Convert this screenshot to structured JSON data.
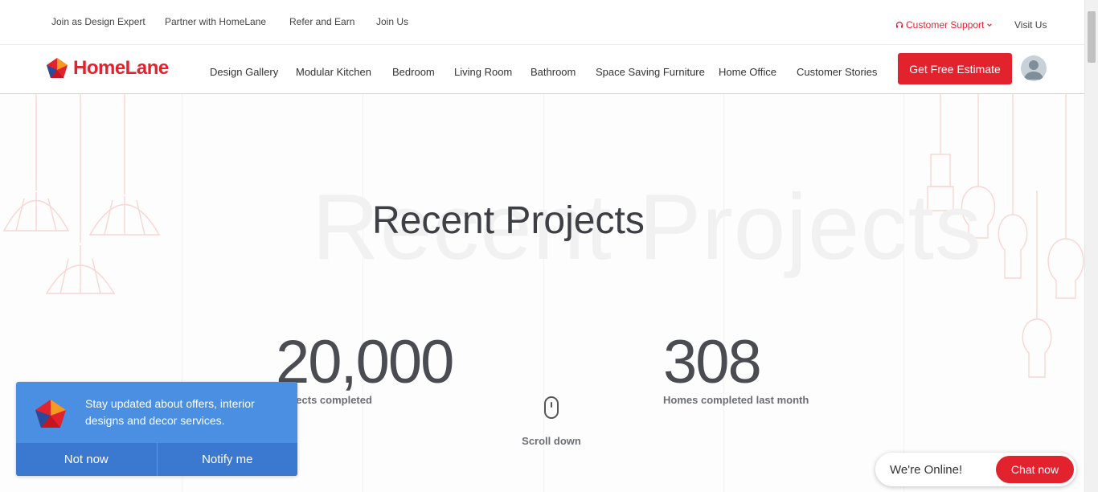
{
  "topbar": {
    "links": [
      {
        "label": "Join as Design Expert"
      },
      {
        "label": "Partner with HomeLane"
      },
      {
        "label": "Refer and Earn"
      },
      {
        "label": "Join Us"
      }
    ],
    "support_label": "Customer Support",
    "visit_label": "Visit Us"
  },
  "navbar": {
    "logo_text": "HomeLane",
    "items": [
      {
        "label": "Design Gallery"
      },
      {
        "label": "Modular Kitchen"
      },
      {
        "label": "Bedroom"
      },
      {
        "label": "Living Room"
      },
      {
        "label": "Bathroom"
      },
      {
        "label": "Space Saving Furniture"
      },
      {
        "label": "Home Office"
      },
      {
        "label": "Customer Stories"
      }
    ],
    "cta_label": "Get Free Estimate"
  },
  "hero": {
    "ghost_title": "Recent Projects",
    "title": "Recent Projects",
    "stats": [
      {
        "value": "20,000",
        "label": "Projects completed"
      },
      {
        "value": "308",
        "label": "Homes completed last month"
      }
    ],
    "scroll_label": "Scroll down"
  },
  "notify": {
    "message": "Stay updated about offers, interior designs and decor services.",
    "decline_label": "Not now",
    "accept_label": "Notify me"
  },
  "chat": {
    "status_text": "We're Online!",
    "button_label": "Chat now"
  },
  "colors": {
    "brand_red": "#e2222d",
    "notify_blue": "#4a8fe2",
    "text_dark": "#3d3f44"
  }
}
